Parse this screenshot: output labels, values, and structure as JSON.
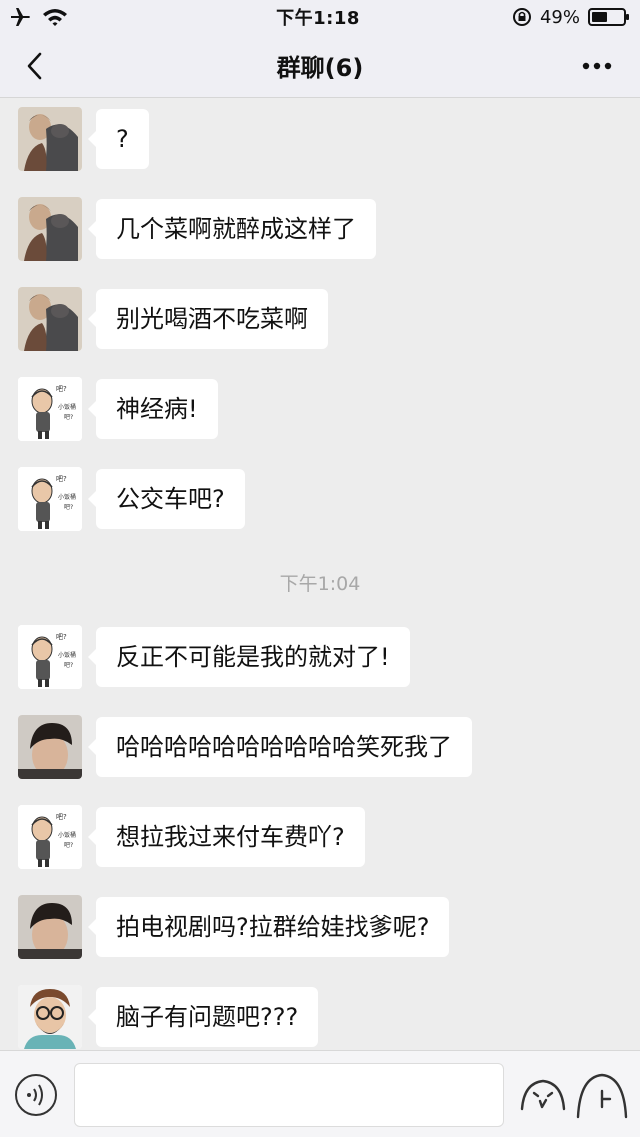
{
  "status_bar": {
    "time": "下午1:18",
    "battery_text": "49%",
    "battery_level": 0.49,
    "icons": [
      "airplane-icon",
      "wifi-icon",
      "orientation-lock-icon",
      "battery-icon"
    ]
  },
  "nav": {
    "title": "群聊(6)",
    "back_icon": "chevron-left-icon",
    "more_icon": "more-dots-icon"
  },
  "messages": [
    {
      "text": "?",
      "avatar": "photo-man-with-cat"
    },
    {
      "text": "几个菜啊就醉成这样了",
      "avatar": "photo-man-with-cat"
    },
    {
      "text": "别光喝酒不吃菜啊",
      "avatar": "photo-man-with-cat"
    },
    {
      "text": "神经病!",
      "avatar": "cartoon-sticker",
      "sticker_text": [
        "吧?",
        "小饭桶",
        "吧?"
      ]
    },
    {
      "text": "公交车吧?",
      "avatar": "cartoon-sticker",
      "sticker_text": [
        "吧?",
        "小饭桶",
        "吧?"
      ]
    },
    {
      "text": "反正不可能是我的就对了!",
      "avatar": "cartoon-sticker",
      "sticker_text": [
        "吧?",
        "小饭桶",
        "吧?"
      ]
    },
    {
      "text": "哈哈哈哈哈哈哈哈哈哈笑死我了",
      "avatar": "photo-boy"
    },
    {
      "text": "想拉我过来付车费吖?",
      "avatar": "cartoon-sticker",
      "sticker_text": [
        "吧?",
        "小饭桶",
        "吧?"
      ]
    },
    {
      "text": "拍电视剧吗?拉群给娃找爹呢?",
      "avatar": "photo-boy"
    },
    {
      "text": "脑子有问题吧???",
      "avatar": "illustrated-man-glasses"
    }
  ],
  "time_separator": "下午1:04",
  "input_bar": {
    "placeholder": "",
    "icons": [
      "voice-icon",
      "emoji-icon",
      "plus-icon"
    ]
  },
  "colors": {
    "background": "#ededed",
    "bubble": "#ffffff",
    "bar": "#efeff4",
    "timestamp": "#a8a8a8"
  }
}
